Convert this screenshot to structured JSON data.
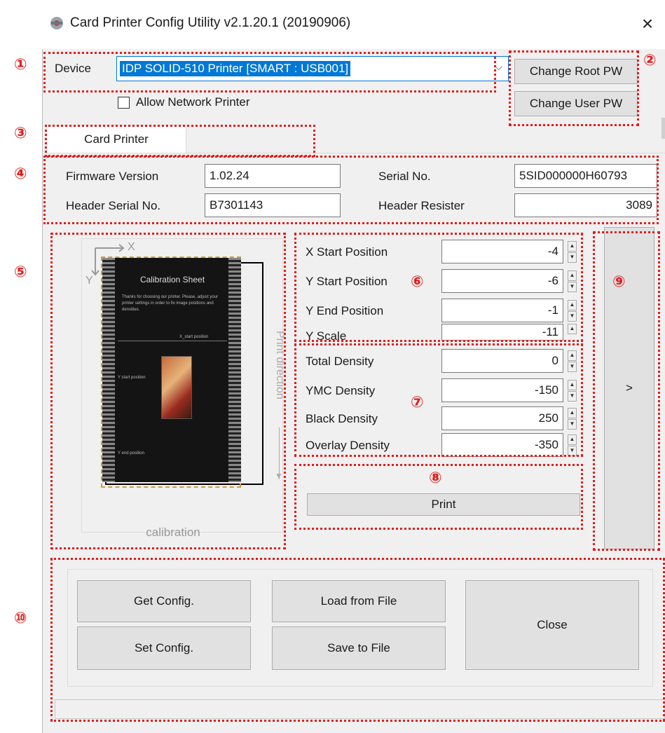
{
  "window": {
    "title": "Card Printer Config Utility v2.1.20.1 (20190906)",
    "close": "×"
  },
  "device": {
    "label": "Device",
    "value": "IDP SOLID-510 Printer  [SMART : USB001]",
    "allow_network": "Allow Network Printer"
  },
  "buttons": {
    "change_root_pw": "Change Root PW",
    "change_user_pw": "Change User PW"
  },
  "tabs": [
    "Card Printer"
  ],
  "info": {
    "firmware_label": "Firmware Version",
    "firmware_value": "1.02.24",
    "serial_label": "Serial No.",
    "serial_value": "5SID000000H60793",
    "header_serial_label": "Header Serial No.",
    "header_serial_value": "B7301143",
    "header_resister_label": "Header Resister",
    "header_resister_value": "3089"
  },
  "preview": {
    "axis_x": "X",
    "axis_y": "Y",
    "sheet_title": "Calibration Sheet",
    "sheet_text": "Thanks for choosing our printer. Please, adjust your printer settings in order to fix image positions and densities.",
    "x_start": "X_start position",
    "y_start": "Y start position",
    "y_end": "Y end position",
    "print_direction": "Print direction",
    "caption": "calibration"
  },
  "position": [
    {
      "label": "X Start Position",
      "value": "-4"
    },
    {
      "label": "Y Start Position",
      "value": "-6"
    },
    {
      "label": "Y End Position",
      "value": "-1"
    },
    {
      "label": "Y Scale",
      "value": "-11"
    }
  ],
  "density": [
    {
      "label": "Total Density",
      "value": "0"
    },
    {
      "label": "YMC Density",
      "value": "-150"
    },
    {
      "label": "Black Density",
      "value": "250"
    },
    {
      "label": "Overlay Density",
      "value": "-350"
    }
  ],
  "print_button": "Print",
  "expand_button": ">",
  "bottom": {
    "get_config": "Get Config.",
    "set_config": "Set Config.",
    "load_file": "Load from File",
    "save_file": "Save to File",
    "close": "Close"
  },
  "annotations": [
    "①",
    "②",
    "③",
    "④",
    "⑤",
    "⑥",
    "⑦",
    "⑧",
    "⑨",
    "⑩"
  ],
  "colors": {
    "annotation": "#e21c1c",
    "selection": "#0078d7",
    "button": "#e1e1e1"
  }
}
